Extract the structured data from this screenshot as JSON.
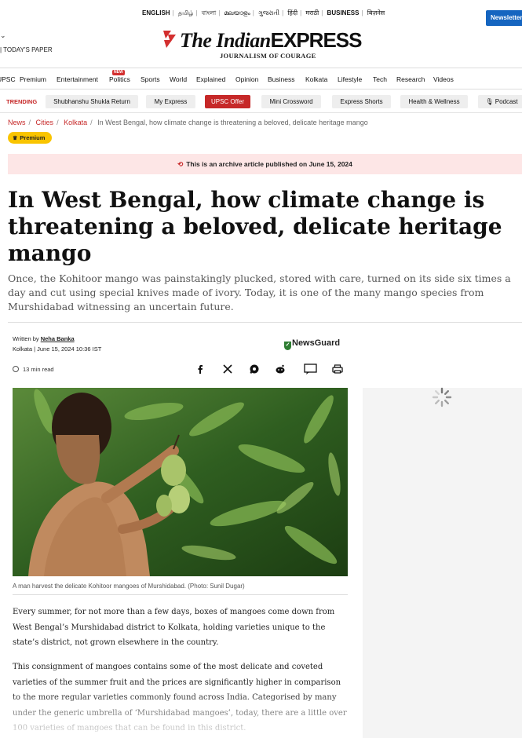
{
  "languages": [
    "ENGLISH",
    "தமிழ்",
    "বাংলা",
    "മലയാളം",
    "ગુજરાતી",
    "हिंदी",
    "मराठी",
    "BUSINESS",
    "बिज़नेस"
  ],
  "newsletter_label": "Newsletters",
  "masthead": {
    "chevron": "⌄",
    "todays_paper": "| TODAY'S PAPER",
    "logo_the": "The",
    "logo_indian": "Indian",
    "logo_express": "EXPRESS",
    "tagline": "JOURNALISM OF COURAGE"
  },
  "nav": {
    "items": [
      "UPSC",
      "Premium",
      "Entertainment",
      "Politics",
      "Sports",
      "World",
      "Explained",
      "Opinion",
      "Business",
      "Kolkata",
      "Lifestyle",
      "Tech",
      "Research",
      "Videos"
    ],
    "new_badge": "NEW"
  },
  "trending": {
    "label": "TRENDING",
    "chips": [
      "Shubhanshu Shukla Return",
      "My Express",
      "UPSC Offer",
      "Mini Crossword",
      "Express Shorts",
      "Health & Wellness",
      "Podcast"
    ]
  },
  "breadcrumb": {
    "items": [
      "News",
      "Cities",
      "Kolkata"
    ],
    "current": "In West Bengal, how climate change is threatening a beloved, delicate heritage mango"
  },
  "premium_label": "Premium",
  "archive_notice": "This is an archive article published on June 15, 2024",
  "article": {
    "headline": "In West Bengal, how climate change is threatening a beloved, delicate heritage mango",
    "standfirst": "Once, the Kohitoor mango was painstakingly plucked, stored with care, turned on its side six times a day and cut using special knives made of ivory. Today, it is one of the many mango species from Murshidabad witnessing an uncertain future.",
    "written_by_label": "Written by",
    "author": "Neha Banka",
    "dateline": "Kolkata | June 15, 2024 10:36 IST",
    "newsguard": "NewsGuard",
    "read_time": "13 min read",
    "caption": "A man harvest the delicate Kohitoor mangoes of Murshidabad. (Photo: Sunil Dugar)",
    "paragraphs": [
      "Every summer, for not more than a few days, boxes of mangoes come down from West Bengal’s Murshidabad district to Kolkata, holding varieties unique to the state’s district, not grown elsewhere in the country.",
      "This consignment of mangoes contains some of the most delicate and coveted varieties of the summer fruit and the prices are significantly higher in comparison to the more regular varieties commonly found across India. Categorised by many under the generic umbrella of ‘Murshidabad mangoes’, today, there are a little over 100 varieties of mangoes that can be found in this district."
    ]
  },
  "share_icons": [
    "facebook-icon",
    "x-icon",
    "whatsapp-icon",
    "reddit-icon",
    "comment-icon",
    "print-icon"
  ],
  "colors": {
    "brand_red": "#c62828",
    "newsletter_blue": "#1565c0",
    "archive_bg": "#fde6e6",
    "premium_yellow": "#f9c400"
  }
}
